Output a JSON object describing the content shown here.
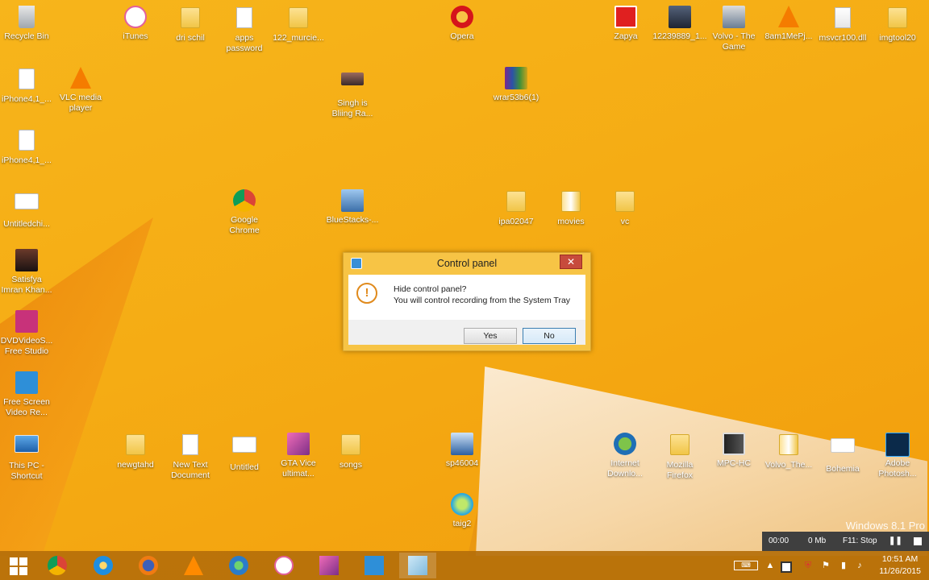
{
  "desktop": {
    "icons": [
      {
        "id": "recycle-bin",
        "label": "Recycle Bin"
      },
      {
        "id": "itunes",
        "label": "iTunes"
      },
      {
        "id": "dri-schil",
        "label": "dri schil"
      },
      {
        "id": "apps-password",
        "label": "apps\npassword"
      },
      {
        "id": "122-murcie",
        "label": "122_murcie..."
      },
      {
        "id": "opera",
        "label": "Opera"
      },
      {
        "id": "zapya",
        "label": "Zapya"
      },
      {
        "id": "photo-12239889",
        "label": "12239889_1..."
      },
      {
        "id": "volvo-the-game",
        "label": "Volvo - The\nGame"
      },
      {
        "id": "8am1mepj",
        "label": "8am1MePj..."
      },
      {
        "id": "msvcr100",
        "label": "msvcr100.dll"
      },
      {
        "id": "imgtool20",
        "label": "imgtool20"
      },
      {
        "id": "iphone41-a",
        "label": "iPhone4,1_..."
      },
      {
        "id": "vlc",
        "label": "VLC media\nplayer"
      },
      {
        "id": "singh-is-bliing",
        "label": "Singh is\nBliing Ra..."
      },
      {
        "id": "wrar",
        "label": "wrar53b6(1)"
      },
      {
        "id": "iphone41-b",
        "label": "iPhone4,1_..."
      },
      {
        "id": "untitledchi",
        "label": "Untitledchi..."
      },
      {
        "id": "google-chrome",
        "label": "Google\nChrome"
      },
      {
        "id": "bluestacks",
        "label": "BlueStacks-..."
      },
      {
        "id": "ipa02047",
        "label": "ipa02047"
      },
      {
        "id": "movies",
        "label": "movies"
      },
      {
        "id": "vc",
        "label": "vc"
      },
      {
        "id": "satisfya",
        "label": "Satisfya\nImran Khan..."
      },
      {
        "id": "dvdvideosoft",
        "label": "DVDVideoS...\nFree Studio"
      },
      {
        "id": "free-screen-video",
        "label": "Free Screen\nVideo Re..."
      },
      {
        "id": "this-pc",
        "label": "This PC -\nShortcut"
      },
      {
        "id": "newgtahd",
        "label": "newgtahd"
      },
      {
        "id": "new-text-document",
        "label": "New Text\nDocument"
      },
      {
        "id": "untitled",
        "label": "Untitled"
      },
      {
        "id": "gta-vice",
        "label": "GTA Vice\nultimat..."
      },
      {
        "id": "songs",
        "label": "songs"
      },
      {
        "id": "sp46004",
        "label": "sp46004"
      },
      {
        "id": "internet-download",
        "label": "Internet\nDownlo..."
      },
      {
        "id": "mozilla-firefox",
        "label": "Mozilla\nFirefox"
      },
      {
        "id": "mpc-hc",
        "label": "MPC-HC"
      },
      {
        "id": "volvo-the-2",
        "label": "Volvo_The..."
      },
      {
        "id": "bohemia",
        "label": "Bohemia"
      },
      {
        "id": "adobe-photoshop",
        "label": "Adobe\nPhotosh..."
      },
      {
        "id": "taig2",
        "label": "taig2"
      }
    ]
  },
  "dialog": {
    "title": "Control panel",
    "close_label": "✕",
    "message_line1": "Hide control panel?",
    "message_line2": "You will control recording from the System Tray",
    "yes_label": "Yes",
    "no_label": "No"
  },
  "watermark": "Windows 8.1 Pro",
  "recorder": {
    "time": "00:00",
    "size": "0 Mb",
    "stop_label": "F11: Stop",
    "pause_label": "❚❚"
  },
  "taskbar": {
    "items": [
      "start",
      "chrome",
      "internet-explorer",
      "firefox",
      "vlc",
      "network-tool",
      "itunes",
      "gta-vice",
      "free-screen-video",
      "notepad"
    ],
    "clock_time": "10:51 AM",
    "clock_date": "11/26/2015"
  },
  "colors": {
    "wallpaper": "#f5ac14",
    "taskbar": "#b56f0a",
    "dialog_frame": "#f7c445",
    "close_button": "#c74b3c"
  }
}
